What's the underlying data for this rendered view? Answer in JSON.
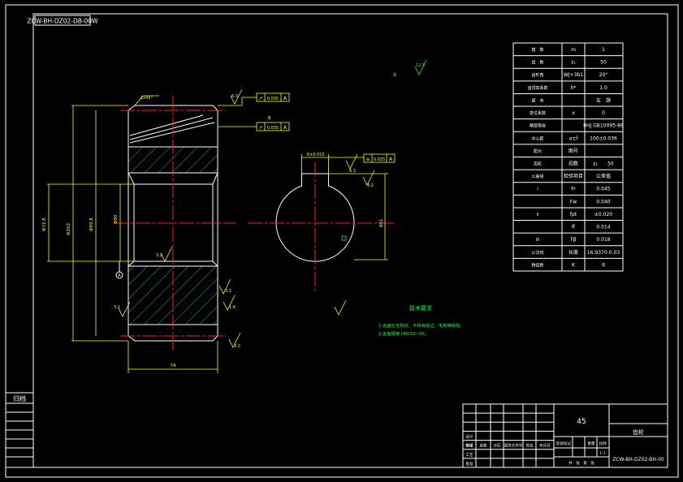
{
  "title_stamp": "ZCW-BH-DZ02-DB-00W",
  "view_label": "A",
  "center_label": "A",
  "gear_dims": {
    "chamfer": "1x45°",
    "face_width": "74",
    "tip_dia": "Φ250",
    "root_dia": "Φ49.8",
    "bore_dia": "Φ80",
    "bore_len": "Φ72.8"
  },
  "roughness": [
    "6.3",
    "3.2",
    "3.2",
    "1.6",
    "3.2",
    "3.2",
    "12.5",
    "6.3",
    "3.2"
  ],
  "tolerance_frames": [
    {
      "symbol": "↗",
      "value": "0.035",
      "datum": "A"
    },
    {
      "symbol": "↗",
      "value": "0.035",
      "datum": "A"
    },
    {
      "symbol": "≡",
      "value": "0.025",
      "datum": "A"
    }
  ],
  "keyway": {
    "width": "6±0.015",
    "depth": "Φ51"
  },
  "label_b": "B",
  "tech_req": {
    "title": "技术要求",
    "lines": [
      "1.齿面应无裂纹、不得有锐边、毛刺等缺陷。",
      "2.齿面硬度 HRC50~55。"
    ]
  },
  "param_table": [
    {
      "label": "模　数",
      "sym": "m",
      "val": "1"
    },
    {
      "label": "齿　数",
      "sym": "z₁",
      "val": "50"
    },
    {
      "label": "齿形角",
      "sym": "WJ+3b1",
      "val": "20°"
    },
    {
      "label": "齿顶高系数",
      "sym": "h*",
      "val": "1.0"
    },
    {
      "label": "旋　向",
      "sym": "",
      "val": "左　旋"
    },
    {
      "label": "变位系数",
      "sym": "x",
      "val": "0"
    },
    {
      "label": "精度等级",
      "sym": "",
      "val": "8HJ GB10095-88"
    },
    {
      "label": "中心距",
      "sym": "a±f",
      "val": "100±0.036"
    },
    {
      "label": "配对",
      "sym": "图号",
      "val": ""
    },
    {
      "label": "齿轮",
      "sym": "齿数",
      "val": "z₂　　50"
    },
    {
      "label": "公差组",
      "sym": "检验项目",
      "val": "公差值"
    },
    {
      "label": "I",
      "sym": "Fr",
      "val": "0.045"
    },
    {
      "label": "",
      "sym": "Fw",
      "val": "0.040"
    },
    {
      "label": "II",
      "sym": "fpt",
      "val": "±0.020"
    },
    {
      "label": "",
      "sym": "ff",
      "val": "0.014"
    },
    {
      "label": "III",
      "sym": "Fβ",
      "val": "0.018"
    },
    {
      "label": "公法线",
      "sym": "长度",
      "val": "16.9370-0.03"
    },
    {
      "label": "跨齿数",
      "sym": "K",
      "val": "6"
    }
  ],
  "title_block": {
    "scale_count": "45",
    "part_name": "齿轮",
    "drawing_no": "ZCW-BH-DZ02-BH-00",
    "row_labels": [
      "标记",
      "处数",
      "分区",
      "更改文件号",
      "签名",
      "年月日"
    ],
    "side_rows": [
      "设计",
      "审核",
      "工艺",
      "批准"
    ],
    "cols": [
      "阶段标记",
      "重量",
      "比例"
    ],
    "ratio": "1:1",
    "sheet": "共　张　第　张"
  },
  "left_stamp": [
    "归档",
    "",
    "",
    "",
    "",
    "",
    "",
    ""
  ]
}
